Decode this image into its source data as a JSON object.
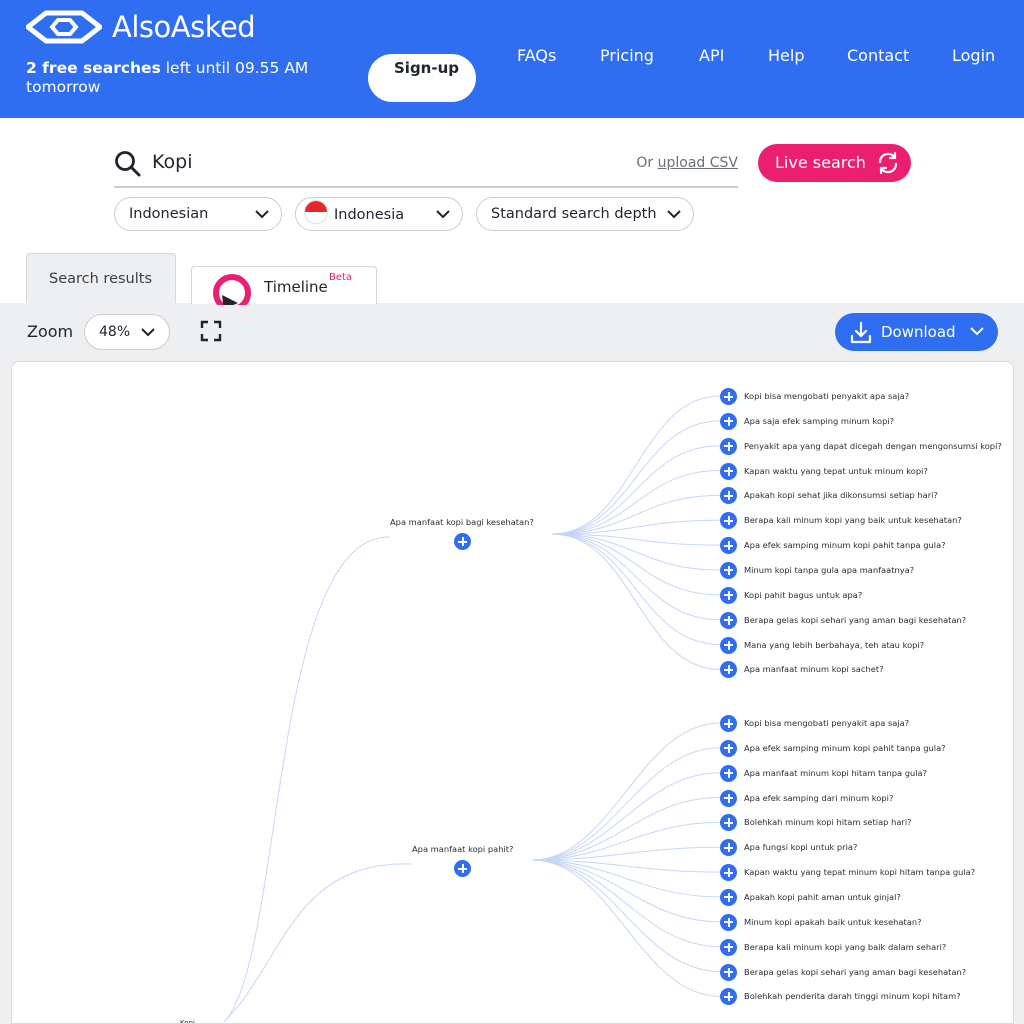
{
  "header": {
    "brand": "AlsoAsked",
    "free_count": "2 free searches",
    "free_rest": " left until 09.55 AM tomorrow",
    "signup_label": "Sign-up",
    "nav": [
      "FAQs",
      "Pricing",
      "API",
      "Help",
      "Contact",
      "Login"
    ]
  },
  "search": {
    "value": "Kopi",
    "or_text": "Or ",
    "csv_link": "upload CSV",
    "live_label": "Live search"
  },
  "filters": {
    "language": "Indonesian",
    "region": "Indonesia",
    "depth": "Standard search depth"
  },
  "tabs": {
    "results": "Search results",
    "timeline": "Timeline",
    "timeline_badge": "Beta"
  },
  "toolbar": {
    "zoom_label": "Zoom",
    "zoom_value": "48%",
    "download_label": "Download"
  },
  "colors": {
    "brand_blue": "#2f6ef0",
    "accent_pink": "#ec1e6f",
    "link_line": "#c6d7f5"
  },
  "tree": {
    "root": "Kopi",
    "groups": [
      {
        "question": "Apa manfaat kopi bagi kesehatan?",
        "children": [
          "Kopi bisa mengobati penyakit apa saja?",
          "Apa saja efek samping minum kopi?",
          "Penyakit apa yang dapat dicegah dengan mengonsumsi kopi?",
          "Kapan waktu yang tepat untuk minum kopi?",
          "Apakah kopi sehat jika dikonsumsi setiap hari?",
          "Berapa kali minum kopi yang baik untuk kesehatan?",
          "Apa efek samping minum kopi pahit tanpa gula?",
          "Minum kopi tanpa gula apa manfaatnya?",
          "Kopi pahit bagus untuk apa?",
          "Berapa gelas kopi sehari yang aman bagi kesehatan?",
          "Mana yang lebih berbahaya, teh atau kopi?",
          "Apa manfaat minum kopi sachet?"
        ]
      },
      {
        "question": "Apa manfaat kopi pahit?",
        "children": [
          "Kopi bisa mengobati penyakit apa saja?",
          "Apa efek samping minum kopi pahit tanpa gula?",
          "Apa manfaat minum kopi hitam tanpa gula?",
          "Apa efek samping dari minum kopi?",
          "Bolehkah minum kopi hitam setiap hari?",
          "Apa fungsi kopi untuk pria?",
          "Kapan waktu yang tepat minum kopi hitam tanpa gula?",
          "Apakah kopi pahit aman untuk ginjal?",
          "Minum kopi apakah baik untuk kesehatan?",
          "Berapa kali minum kopi yang baik dalam sehari?",
          "Berapa gelas kopi sehari yang aman bagi kesehatan?",
          "Bolehkah penderita darah tinggi minum kopi hitam?"
        ]
      }
    ]
  }
}
